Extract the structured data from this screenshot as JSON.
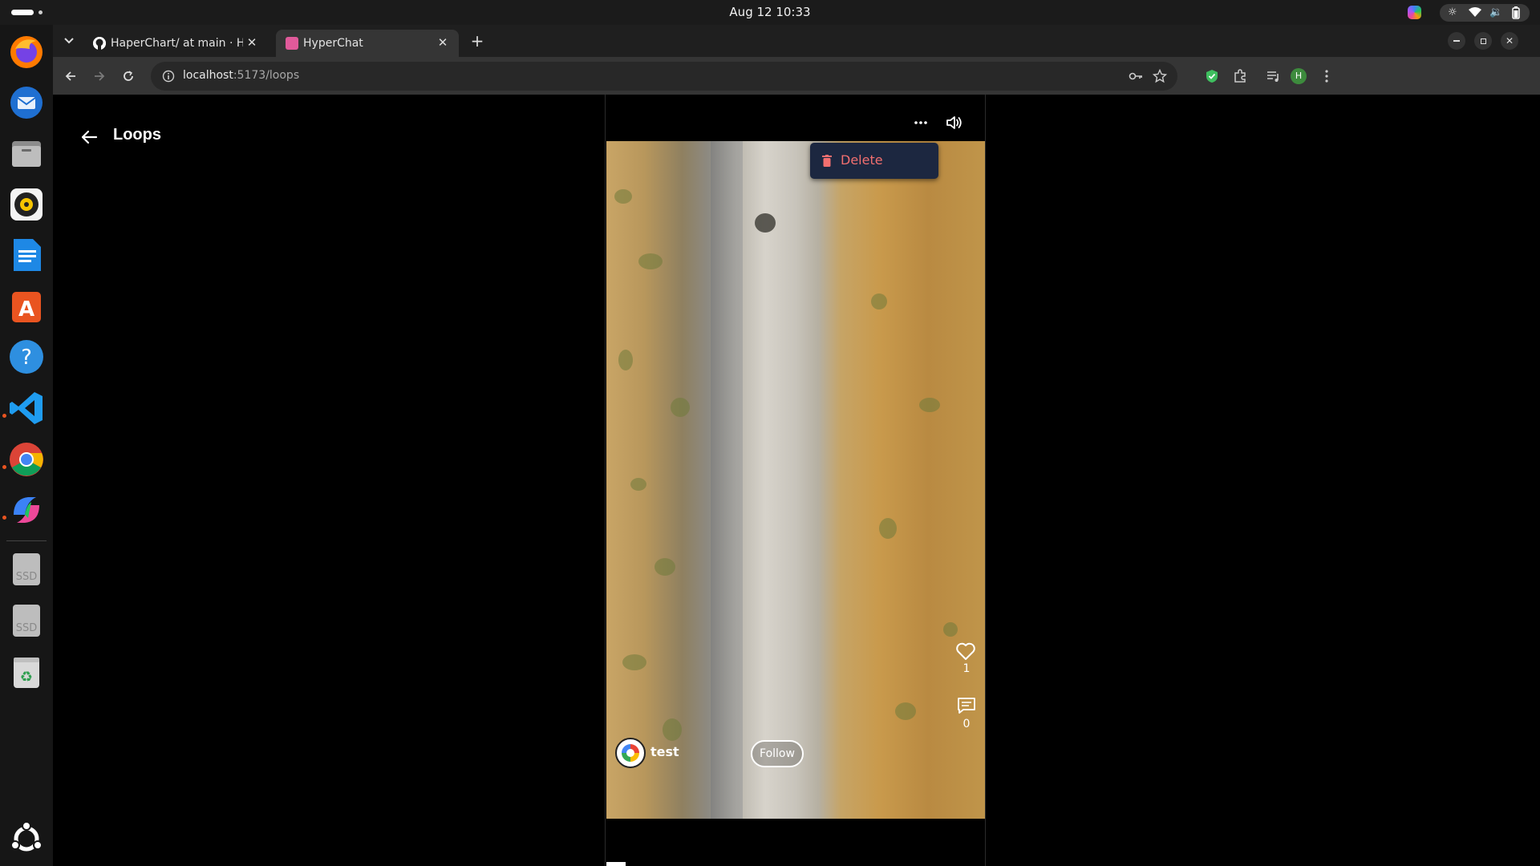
{
  "system": {
    "clock": "Aug 12  10:33"
  },
  "browser": {
    "tabs": [
      {
        "title": "HaperChart/ at main · He",
        "active": false
      },
      {
        "title": "HyperChat",
        "active": true
      }
    ],
    "url_host": "localhost",
    "url_path": ":5173/loops",
    "profile_initial": "H"
  },
  "page": {
    "title": "Loops"
  },
  "loop": {
    "menu": {
      "delete_label": "Delete"
    },
    "likes": "1",
    "comments": "0",
    "username": "test",
    "follow_label": "Follow",
    "progress": 0.05
  },
  "dock": {
    "items": [
      "firefox-icon",
      "thunderbird-icon",
      "files-icon",
      "rhythmbox-icon",
      "writer-icon",
      "app-center-icon",
      "help-icon",
      "vscode-icon",
      "chrome-icon",
      "copilot-icon",
      "ssd-drive-icon",
      "ssd-drive-icon",
      "trash-icon",
      "ubuntu-logo-icon"
    ],
    "ssd_label": "SSD"
  }
}
